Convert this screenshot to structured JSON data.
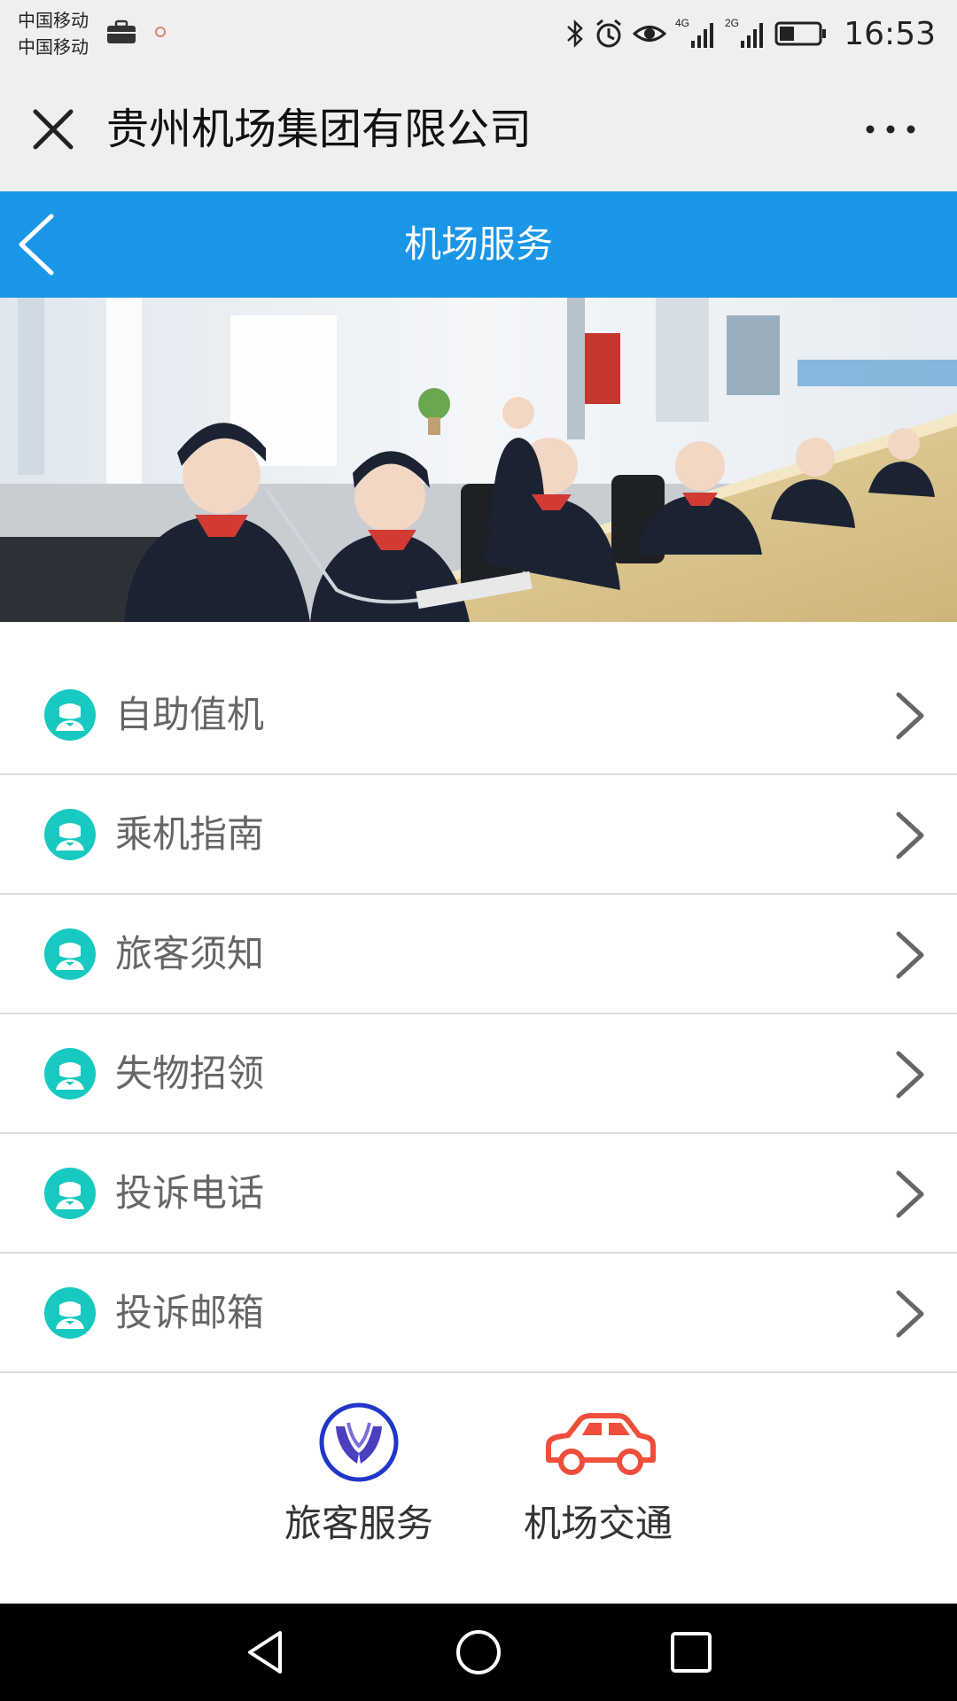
{
  "status_bar": {
    "carrier_1": "中国移动",
    "carrier_2": "中国移动",
    "network_1": "4G",
    "network_2": "2G",
    "time": "16:53"
  },
  "wechat_bar": {
    "title": "贵州机场集团有限公司"
  },
  "app_header": {
    "title": "机场服务"
  },
  "menu": {
    "items": [
      {
        "label": "自助值机",
        "icon": "service-agent-icon"
      },
      {
        "label": "乘机指南",
        "icon": "service-agent-icon"
      },
      {
        "label": "旅客须知",
        "icon": "service-agent-icon"
      },
      {
        "label": "失物招领",
        "icon": "service-agent-icon"
      },
      {
        "label": "投诉电话",
        "icon": "service-agent-icon"
      },
      {
        "label": "投诉邮箱",
        "icon": "service-agent-icon"
      }
    ]
  },
  "bottom_tabs": [
    {
      "label": "旅客服务",
      "icon": "hands-icon"
    },
    {
      "label": "机场交通",
      "icon": "car-icon"
    }
  ],
  "colors": {
    "header_blue": "#1a96e6",
    "icon_teal": "#17c9c0",
    "car_red": "#ef4e3a",
    "hands_blue": "#2037c8"
  }
}
